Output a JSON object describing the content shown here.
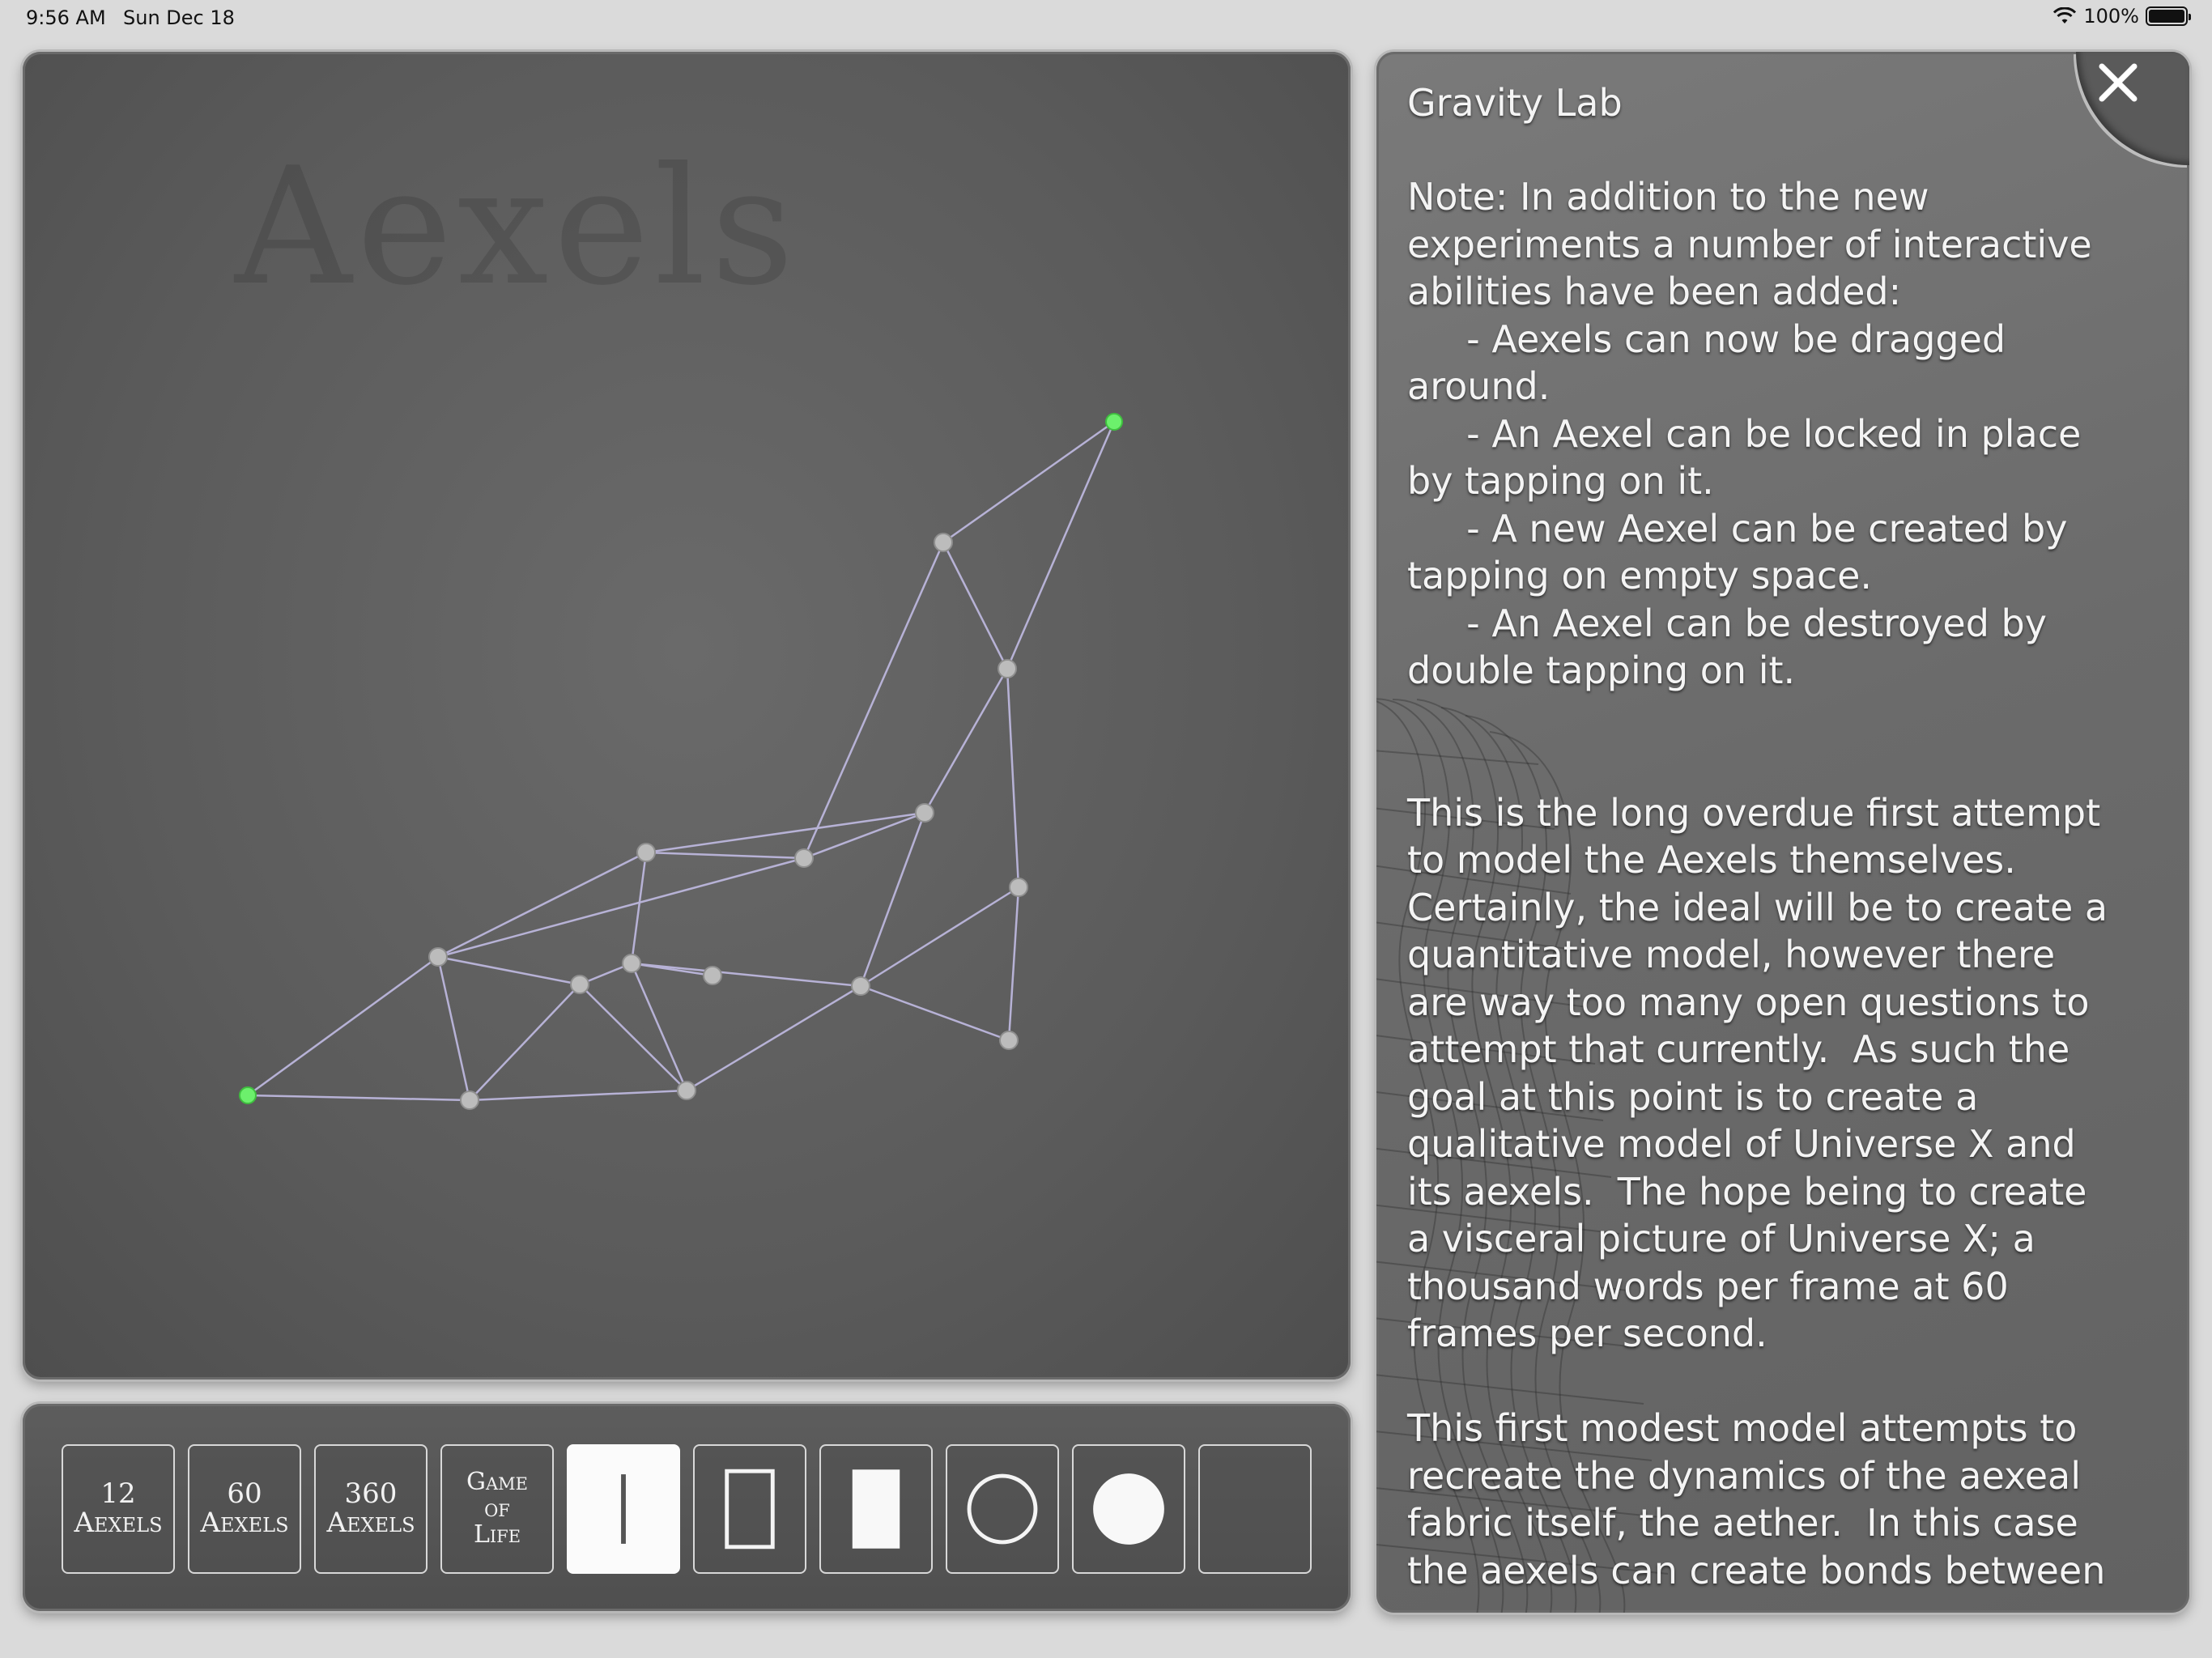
{
  "status_bar": {
    "time": "9:56 AM",
    "date": "Sun Dec 18",
    "battery_text": "100%",
    "battery_level": 1.0
  },
  "simulation": {
    "watermark": "Aexels",
    "colors": {
      "edge": "#b7b2d6",
      "node": "#bcbcbc",
      "locked_node": "#6cf06c"
    },
    "nodes": [
      {
        "id": "n0",
        "locked": true
      },
      {
        "id": "n1",
        "locked": false
      },
      {
        "id": "n2",
        "locked": false
      },
      {
        "id": "n3",
        "locked": false
      },
      {
        "id": "n4",
        "locked": false
      },
      {
        "id": "n5",
        "locked": false
      },
      {
        "id": "n6",
        "locked": false
      },
      {
        "id": "n7",
        "locked": false
      },
      {
        "id": "n8",
        "locked": false
      },
      {
        "id": "n9",
        "locked": false
      },
      {
        "id": "n10",
        "locked": false
      },
      {
        "id": "n11",
        "locked": false
      },
      {
        "id": "n12",
        "locked": false
      },
      {
        "id": "n13",
        "locked": false
      },
      {
        "id": "n14",
        "locked": false
      },
      {
        "id": "n15",
        "locked": true
      }
    ],
    "edges": [
      [
        "n0",
        "n1"
      ],
      [
        "n1",
        "n2"
      ],
      [
        "n2",
        "n3"
      ],
      [
        "n3",
        "n4"
      ],
      [
        "n4",
        "n5"
      ],
      [
        "n5",
        "n6"
      ],
      [
        "n6",
        "n15"
      ],
      [
        "n15",
        "n7"
      ],
      [
        "n7",
        "n8"
      ],
      [
        "n8",
        "n9"
      ],
      [
        "n9",
        "n10"
      ],
      [
        "n10",
        "n11"
      ],
      [
        "n0",
        "n12"
      ],
      [
        "n12",
        "n2"
      ],
      [
        "n12",
        "n13"
      ],
      [
        "n13",
        "n3"
      ],
      [
        "n13",
        "n14"
      ],
      [
        "n14",
        "n4"
      ],
      [
        "n12",
        "n1"
      ],
      [
        "n14",
        "n5"
      ],
      [
        "n14",
        "n10"
      ],
      [
        "n14",
        "n11"
      ],
      [
        "n13",
        "n4"
      ],
      [
        "n11",
        "n3"
      ],
      [
        "n10",
        "n4"
      ],
      [
        "n10",
        "n9"
      ],
      [
        "n9",
        "n5"
      ],
      [
        "n9",
        "n6"
      ],
      [
        "n8",
        "n6"
      ],
      [
        "n7",
        "n6"
      ],
      [
        "n4",
        "n3"
      ],
      [
        "n11",
        "n10"
      ]
    ]
  },
  "toolbar": {
    "buttons": [
      {
        "name": "btn-12-aexels",
        "line1": "12",
        "line2": "Aexels"
      },
      {
        "name": "btn-60-aexels",
        "line1": "60",
        "line2": "Aexels"
      },
      {
        "name": "btn-360-aexels",
        "line1": "360",
        "line2": "Aexels"
      },
      {
        "name": "btn-game-of-life",
        "line1": "Game",
        "line2": "of",
        "line3": "Life"
      },
      {
        "name": "btn-line",
        "icon": "line-icon",
        "selected": true
      },
      {
        "name": "btn-rect-outline",
        "icon": "rectangle-outline-icon"
      },
      {
        "name": "btn-rect-filled",
        "icon": "rectangle-filled-icon"
      },
      {
        "name": "btn-circle-outline",
        "icon": "circle-outline-icon"
      },
      {
        "name": "btn-circle-filled",
        "icon": "circle-filled-icon"
      },
      {
        "name": "btn-empty",
        "icon": "blank"
      }
    ]
  },
  "info": {
    "title": "Gravity Lab",
    "body": "Note: In addition to the new\nexperiments a number of interactive\nabilities have been added:\n     - Aexels can now be dragged\naround.\n     - An Aexel can be locked in place\nby tapping on it.\n     - A new Aexel can be created by\ntapping on empty space.\n     - An Aexel can be destroyed by\ndouble tapping on it.\n\n\nThis is the long overdue first attempt\nto model the Aexels themselves.\nCertainly, the ideal will be to create a\nquantitative model, however there\nare way too many open questions to\nattempt that currently.  As such the\ngoal at this point is to create a\nqualitative model of Universe X and\nits aexels.  The hope being to create\na visceral picture of Universe X; a\nthousand words per frame at 60\nframes per second.\n\nThis first modest model attempts to\nrecreate the dynamics of the aexeal\nfabric itself, the aether.  In this case\nthe aexels can create bonds between",
    "close_icon": "close-icon"
  }
}
